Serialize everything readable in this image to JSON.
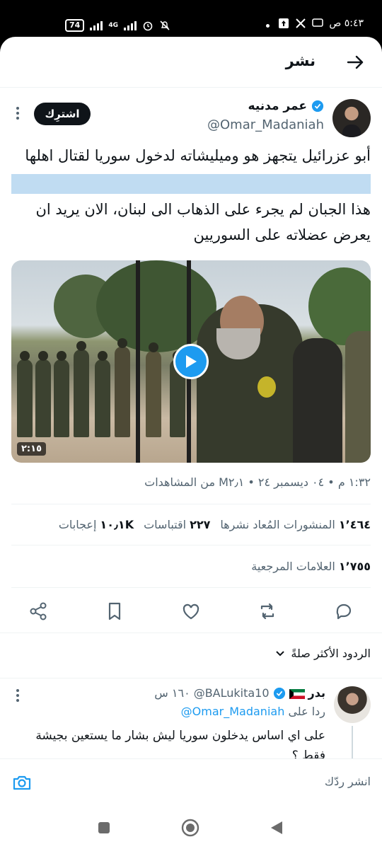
{
  "statusbar": {
    "battery": "74",
    "network": "4G",
    "time": "٥:٤٣ ص"
  },
  "header": {
    "title": "نشر"
  },
  "tweet": {
    "author_name": "عمر مدنيه",
    "author_handle": "@Omar_Madaniah",
    "subscribe_label": "اشترِك",
    "text_line1": "أبو عزرائيل يتجهز هو وميليشاته لدخول سوريا لقتال اهلها",
    "text_line2": "هذا الجبان لم يجرء على الذهاب الى لبنان، الان يريد ان يعرض عضلاته على السوريين",
    "video_duration": "٢:١٥",
    "meta": "١:٣٢ م • ٠٤ ديسمبر ٢٤ • M٢٫١ من المشاهدات",
    "reposts_count": "١٬٤٦٤",
    "reposts_label": "المنشورات المُعاد نشرها",
    "quotes_count": "٢٢٧",
    "quotes_label": "اقتباسات",
    "likes_count": "١٠٫١K",
    "likes_label": "إعجابات",
    "bookmarks_count": "١٬٧٥٥",
    "bookmarks_label": "العلامات المرجعية"
  },
  "sort": {
    "label": "الردود الأكثر صلةً"
  },
  "reply": {
    "name": "بدر",
    "handle": "@BALukita10",
    "time": "١٦٠ س",
    "replying_prefix": "ردا على",
    "replying_to": "@Omar_Madaniah",
    "text": "على اي اساس يدخلون سوريا ليش بشار ما يستعين بجيشة فقط ؟"
  },
  "composer": {
    "placeholder": "انشر ردّك"
  },
  "colors": {
    "accent": "#1d9bf0",
    "text": "#0f1419",
    "secondary": "#536471",
    "highlight": "#c0dcf2"
  },
  "icons": [
    "back-arrow-icon",
    "verified-icon",
    "more-icon",
    "play-icon",
    "share-icon",
    "bookmark-icon",
    "heart-icon",
    "repost-icon",
    "reply-icon",
    "chevron-down-icon",
    "camera-icon",
    "kuwait-flag-icon"
  ]
}
